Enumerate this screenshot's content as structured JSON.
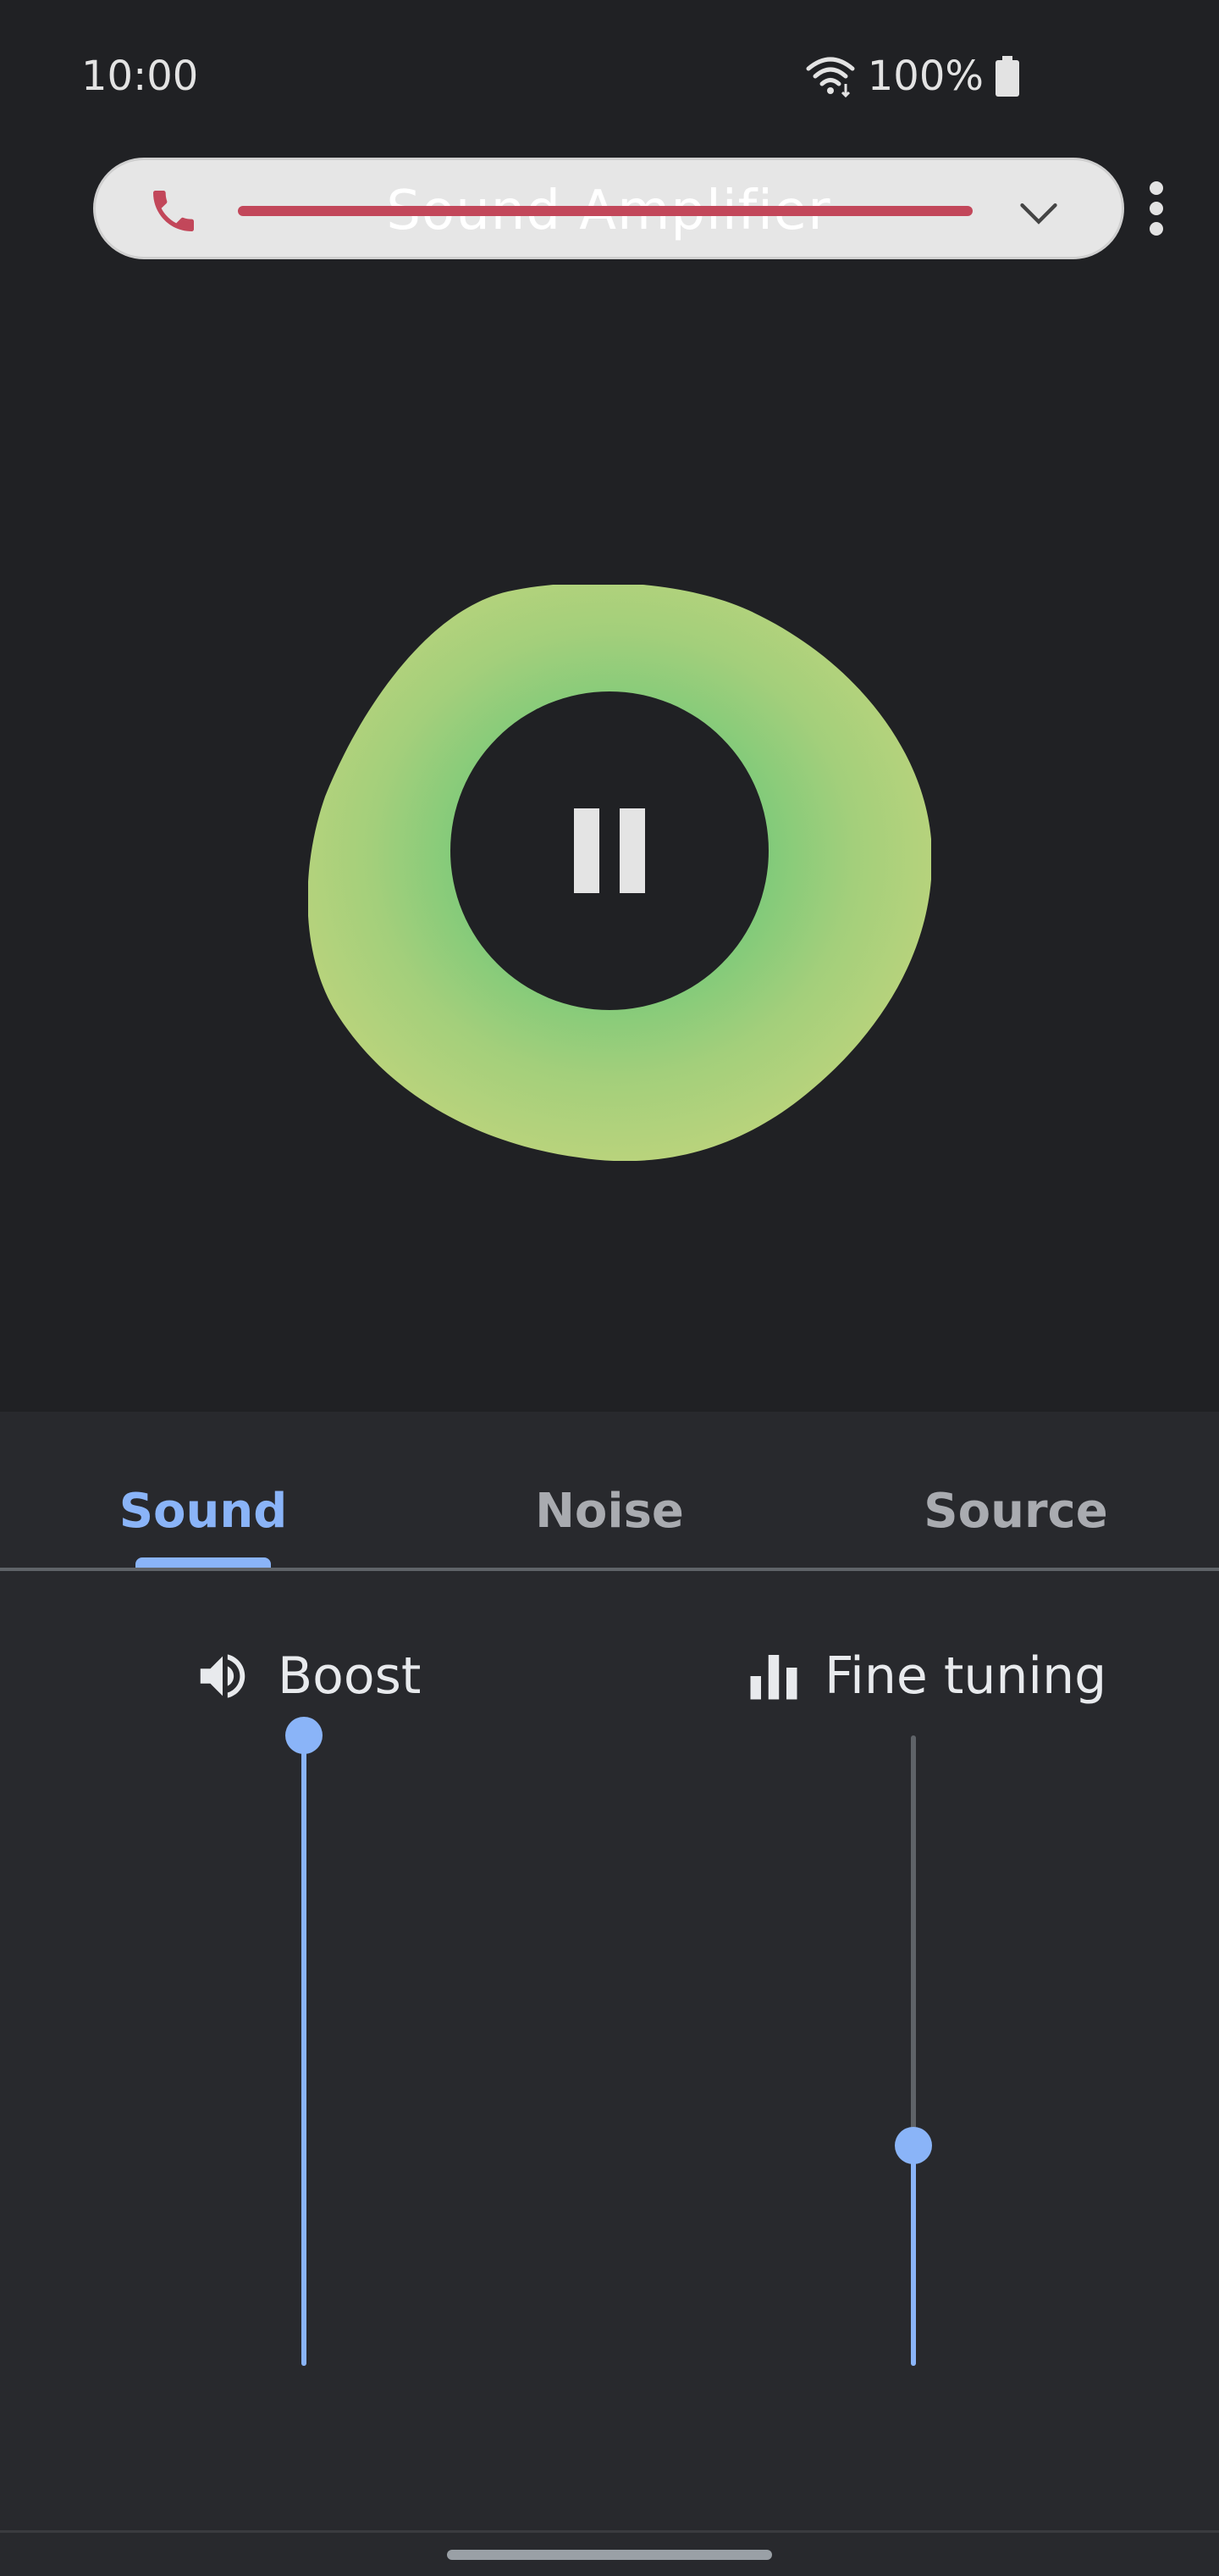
{
  "status_bar": {
    "time": "10:00",
    "battery_text": "100%",
    "icons": [
      "wifi-icon",
      "battery-icon"
    ]
  },
  "header": {
    "title": "Sound Amplifier",
    "left_icon": "phone-icon",
    "right_icon": "chevron-down-icon",
    "menu_icon": "more-vertical-icon",
    "accent_color": "#c2475a"
  },
  "visualizer": {
    "state": "playing",
    "button_icon": "pause-icon",
    "colors": [
      "#78c97a",
      "#b6d47c"
    ]
  },
  "tabs": [
    {
      "label": "Sound",
      "active": true
    },
    {
      "label": "Noise",
      "active": false
    },
    {
      "label": "Source",
      "active": false
    }
  ],
  "sliders": {
    "boost": {
      "label": "Boost",
      "icon": "volume-icon",
      "value": 1.0
    },
    "fine_tuning": {
      "label": "Fine tuning",
      "icon": "equalizer-icon",
      "value": 0.35
    }
  },
  "theme": {
    "accent": "#8ab4f8",
    "background": "#202124",
    "panel": "#28292d"
  }
}
